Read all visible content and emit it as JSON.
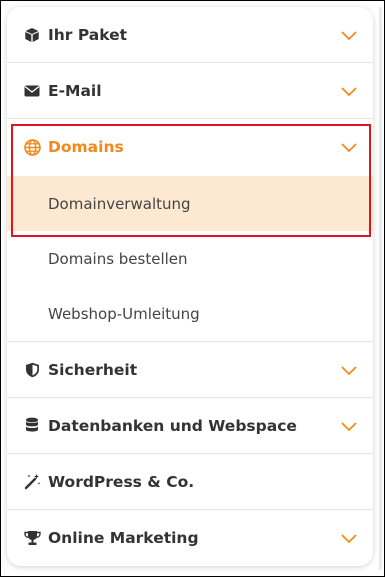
{
  "colors": {
    "accent": "#f08a1c",
    "active_bg": "#fde9d2",
    "highlight_border": "#e0161d",
    "text": "#333333"
  },
  "menu": {
    "items": [
      {
        "label": "Ihr Paket",
        "icon": "package-icon",
        "expandable": true
      },
      {
        "label": "E-Mail",
        "icon": "envelope-icon",
        "expandable": true
      },
      {
        "label": "Domains",
        "icon": "globe-icon",
        "expandable": true,
        "expanded": true,
        "subitems": [
          {
            "label": "Domainverwaltung",
            "selected": true
          },
          {
            "label": "Domains bestellen"
          },
          {
            "label": "Webshop-Umleitung"
          }
        ]
      },
      {
        "label": "Sicherheit",
        "icon": "shield-icon",
        "expandable": true
      },
      {
        "label": "Datenbanken und Webspace",
        "icon": "database-icon",
        "expandable": true
      },
      {
        "label": "WordPress & Co.",
        "icon": "magic-wand-icon",
        "expandable": false
      },
      {
        "label": "Online Marketing",
        "icon": "trophy-icon",
        "expandable": true
      }
    ]
  }
}
